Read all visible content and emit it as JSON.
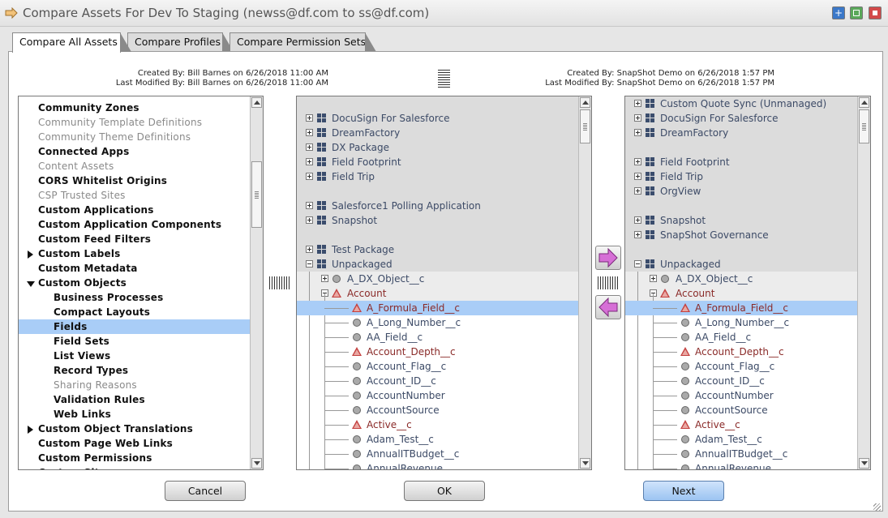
{
  "window": {
    "title": "Compare Assets For Dev To Staging (newss@df.com to ss@df.com)"
  },
  "tabs": [
    {
      "label": "Compare All Assets"
    },
    {
      "label": "Compare Profiles"
    },
    {
      "label": "Compare Permission Sets"
    }
  ],
  "left_meta": {
    "created": "Created By: Bill Barnes on 6/26/2018 11:00 AM",
    "modified": "Last Modified By: Bill Barnes on 6/26/2018 11:00 AM"
  },
  "right_meta": {
    "created": "Created By: SnapShot Demo on 6/26/2018 1:57 PM",
    "modified": "Last Modified By: SnapShot Demo on 6/26/2018 1:57 PM"
  },
  "categories": [
    {
      "label": "Community Zones"
    },
    {
      "label": "Community Template Definitions"
    },
    {
      "label": "Community Theme Definitions"
    },
    {
      "label": "Connected Apps"
    },
    {
      "label": "Content Assets"
    },
    {
      "label": "CORS Whitelist Origins"
    },
    {
      "label": "CSP Trusted Sites"
    },
    {
      "label": "Custom Applications"
    },
    {
      "label": "Custom Application Components"
    },
    {
      "label": "Custom Feed Filters"
    },
    {
      "label": "Custom Labels"
    },
    {
      "label": "Custom Metadata"
    },
    {
      "label": "Custom Objects"
    },
    {
      "label": "Business Processes"
    },
    {
      "label": "Compact Layouts"
    },
    {
      "label": "Fields"
    },
    {
      "label": "Field Sets"
    },
    {
      "label": "List Views"
    },
    {
      "label": "Record Types"
    },
    {
      "label": "Sharing Reasons"
    },
    {
      "label": "Validation Rules"
    },
    {
      "label": "Web Links"
    },
    {
      "label": "Custom Object Translations"
    },
    {
      "label": "Custom Page Web Links"
    },
    {
      "label": "Custom Permissions"
    },
    {
      "label": "Custom Sites"
    }
  ],
  "left_tree": {
    "packages": [
      {
        "label": "DocuSign For Salesforce"
      },
      {
        "label": "DreamFactory"
      },
      {
        "label": "DX Package"
      },
      {
        "label": "Field Footprint"
      },
      {
        "label": "Field Trip"
      },
      {
        "label": "Salesforce1 Polling Application"
      },
      {
        "label": "Snapshot"
      },
      {
        "label": "Test Package"
      },
      {
        "label": "Unpackaged"
      }
    ],
    "objects": [
      {
        "label": "A_DX_Object__c"
      },
      {
        "label": "Account"
      }
    ]
  },
  "right_tree": {
    "packages": [
      {
        "label": "Custom Quote Sync (Unmanaged)"
      },
      {
        "label": "DocuSign For Salesforce"
      },
      {
        "label": "DreamFactory"
      },
      {
        "label": "Field Footprint"
      },
      {
        "label": "Field Trip"
      },
      {
        "label": "OrgView"
      },
      {
        "label": "Snapshot"
      },
      {
        "label": "SnapShot Governance"
      },
      {
        "label": "Unpackaged"
      }
    ],
    "objects": [
      {
        "label": "A_DX_Object__c"
      },
      {
        "label": "Account"
      }
    ]
  },
  "fields": [
    {
      "label": "A_Formula_Field__c",
      "kind": "diff"
    },
    {
      "label": "A_Long_Number__c",
      "kind": "same"
    },
    {
      "label": "AA_Field__c",
      "kind": "same"
    },
    {
      "label": "Account_Depth__c",
      "kind": "diff"
    },
    {
      "label": "Account_Flag__c",
      "kind": "same"
    },
    {
      "label": "Account_ID__c",
      "kind": "same"
    },
    {
      "label": "AccountNumber",
      "kind": "same"
    },
    {
      "label": "AccountSource",
      "kind": "same"
    },
    {
      "label": "Active__c",
      "kind": "diff"
    },
    {
      "label": "Adam_Test__c",
      "kind": "same"
    },
    {
      "label": "AnnualITBudget__c",
      "kind": "same"
    },
    {
      "label": "AnnualRevenue",
      "kind": "same"
    }
  ],
  "buttons": {
    "cancel": "Cancel",
    "ok": "OK",
    "next": "Next"
  },
  "colors": {
    "selection": "#a9cdf7",
    "diff_icon": "#c4403f",
    "copy_right_arrow": "#d66fd6"
  }
}
